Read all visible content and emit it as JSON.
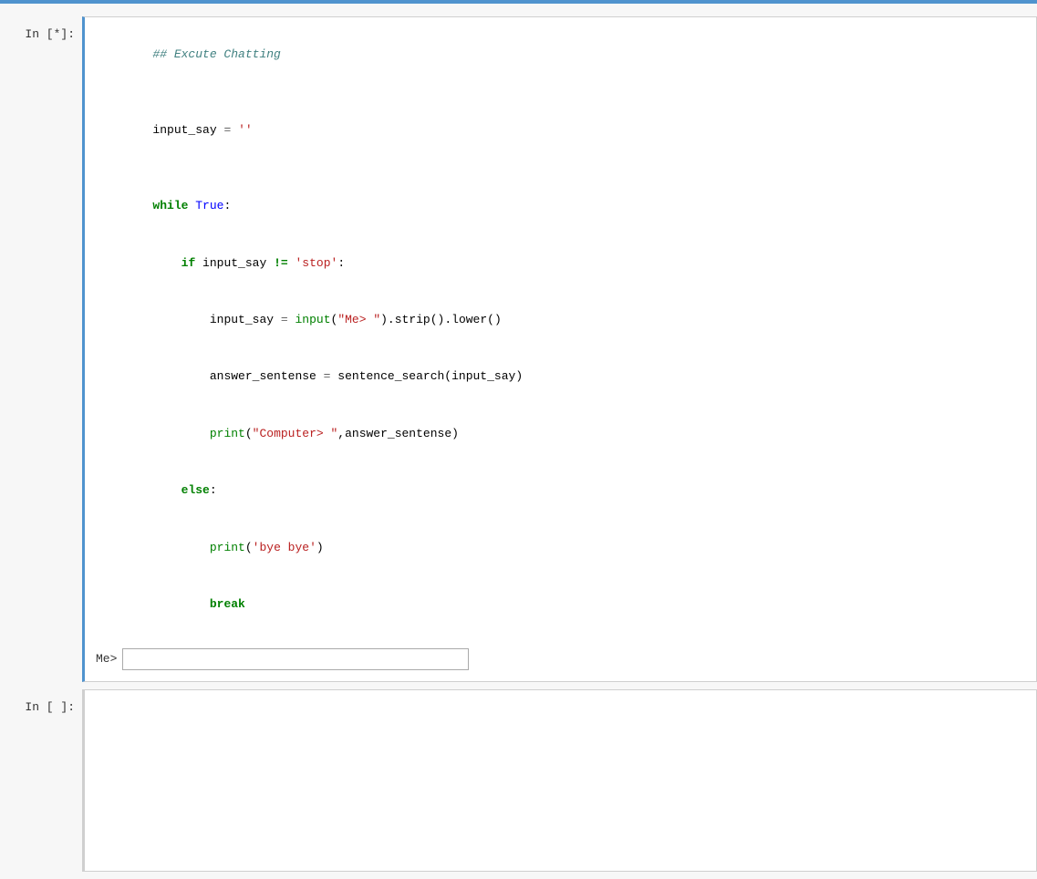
{
  "notebook": {
    "topbar_color": "#4f93ce",
    "cells": [
      {
        "id": "cell-1",
        "label": "In [*]:",
        "state": "running",
        "active": true,
        "code_lines": [
          {
            "indent": 0,
            "tokens": [
              {
                "type": "comment",
                "text": "## Excute Chatting"
              }
            ]
          },
          {
            "indent": 0,
            "tokens": []
          },
          {
            "indent": 0,
            "tokens": [
              {
                "type": "black",
                "text": "input_say "
              },
              {
                "type": "assign",
                "text": "="
              },
              {
                "type": "black",
                "text": " "
              },
              {
                "type": "string",
                "text": "''"
              }
            ]
          },
          {
            "indent": 0,
            "tokens": []
          },
          {
            "indent": 0,
            "tokens": [
              {
                "type": "kw-green",
                "text": "while"
              },
              {
                "type": "black",
                "text": " "
              },
              {
                "type": "kw-blue",
                "text": "True"
              },
              {
                "type": "black",
                "text": ":"
              }
            ]
          },
          {
            "indent": 4,
            "tokens": [
              {
                "type": "kw-green",
                "text": "if"
              },
              {
                "type": "black",
                "text": " input_say "
              },
              {
                "type": "kw-green",
                "text": "!="
              },
              {
                "type": "black",
                "text": " "
              },
              {
                "type": "string",
                "text": "'stop'"
              },
              {
                "type": "black",
                "text": ":"
              }
            ]
          },
          {
            "indent": 8,
            "tokens": [
              {
                "type": "black",
                "text": "input_say "
              },
              {
                "type": "assign",
                "text": "="
              },
              {
                "type": "black",
                "text": " "
              },
              {
                "type": "kw-builtin",
                "text": "input"
              },
              {
                "type": "black",
                "text": "("
              },
              {
                "type": "string",
                "text": "\"Me> \""
              },
              {
                "type": "black",
                "text": ").strip().lower()"
              }
            ]
          },
          {
            "indent": 8,
            "tokens": [
              {
                "type": "black",
                "text": "answer_sentense "
              },
              {
                "type": "assign",
                "text": "="
              },
              {
                "type": "black",
                "text": " sentence_search(input_say)"
              }
            ]
          },
          {
            "indent": 8,
            "tokens": [
              {
                "type": "kw-builtin",
                "text": "print"
              },
              {
                "type": "black",
                "text": "("
              },
              {
                "type": "string",
                "text": "\"Computer> \""
              },
              {
                "type": "black",
                "text": ",answer_sentense)"
              }
            ]
          },
          {
            "indent": 4,
            "tokens": [
              {
                "type": "kw-green",
                "text": "else"
              },
              {
                "type": "black",
                "text": ":"
              }
            ]
          },
          {
            "indent": 8,
            "tokens": [
              {
                "type": "kw-builtin",
                "text": "print"
              },
              {
                "type": "black",
                "text": "("
              },
              {
                "type": "string",
                "text": "'bye bye'"
              },
              {
                "type": "black",
                "text": ")"
              }
            ]
          },
          {
            "indent": 8,
            "tokens": [
              {
                "type": "kw-green",
                "text": "break"
              }
            ]
          }
        ],
        "output": {
          "has_input_prompt": true,
          "prompt_label": "Me>",
          "input_value": ""
        }
      },
      {
        "id": "cell-2",
        "label": "In [ ]:",
        "state": "empty",
        "active": false,
        "code_lines": [],
        "output": null
      }
    ]
  }
}
